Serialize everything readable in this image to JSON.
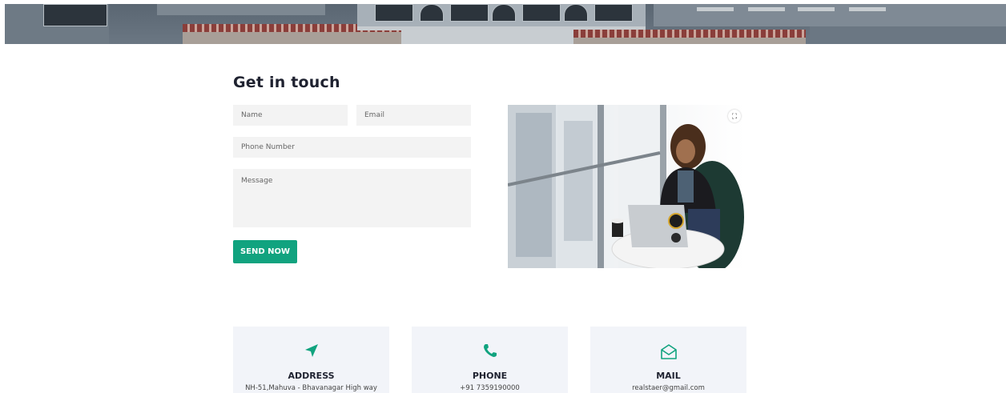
{
  "contact": {
    "title": "Get in touch",
    "name_placeholder": "Name",
    "email_placeholder": "Email",
    "phone_placeholder": "Phone Number",
    "message_placeholder": "Message",
    "send_label": "SEND NOW"
  },
  "info_cards": [
    {
      "icon": "navigation-arrow-icon",
      "title": "ADDRESS",
      "value": "NH-51,Mahuva - Bhavanagar High way"
    },
    {
      "icon": "phone-icon",
      "title": "PHONE",
      "value": "+91 7359190000"
    },
    {
      "icon": "mail-open-icon",
      "title": "MAIL",
      "value": "realstaer@gmail.com"
    }
  ],
  "colors": {
    "accent": "#11a37f",
    "card_bg": "#f2f4f9",
    "field_bg": "#f3f3f3",
    "heading": "#1f2230"
  }
}
